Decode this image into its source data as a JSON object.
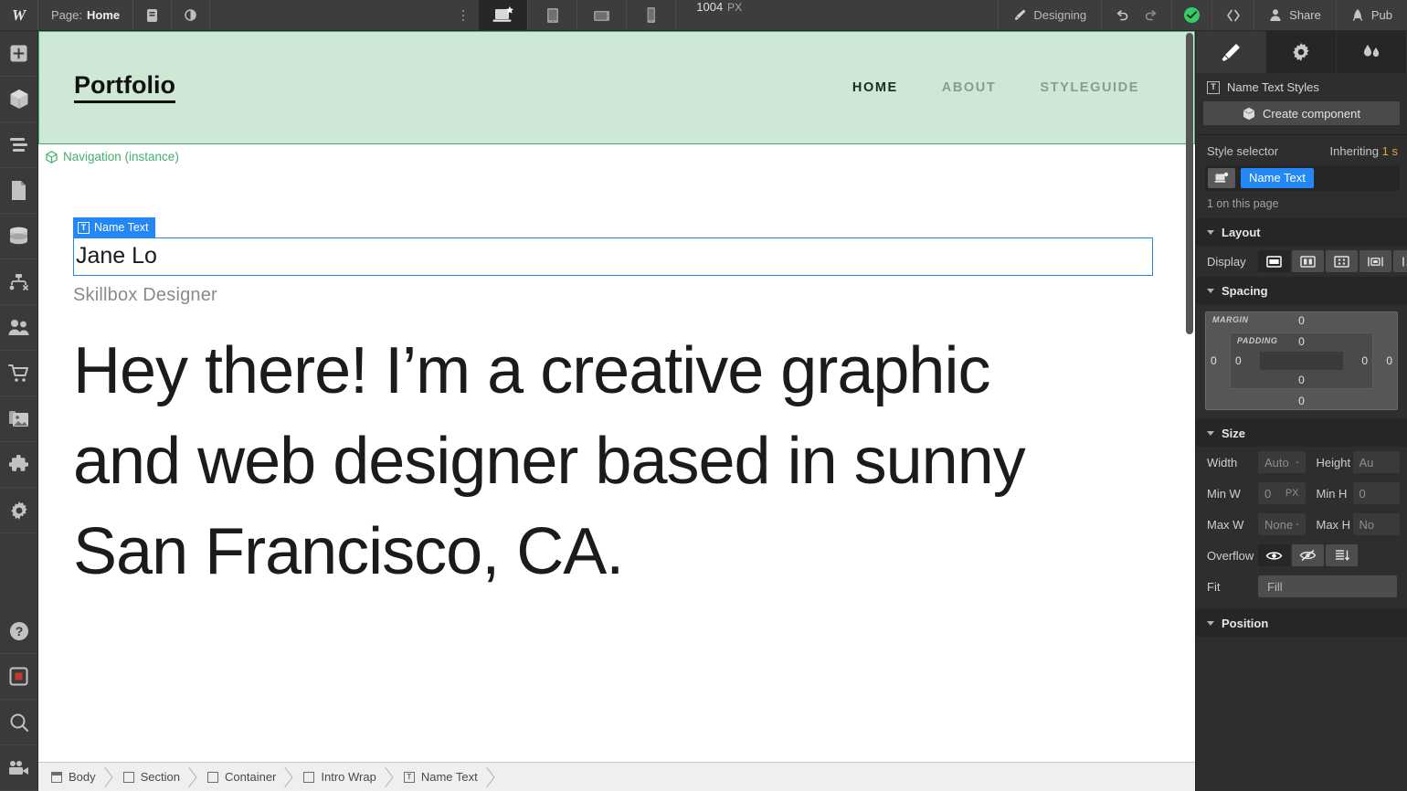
{
  "topbar": {
    "logo": "W",
    "page_label": "Page:",
    "page_name": "Home",
    "viewport_width": "1004",
    "viewport_unit": "PX",
    "mode_label": "Designing",
    "share_label": "Share",
    "publish_label": "Pub",
    "breakpoints": [
      {
        "name": "desktop",
        "active": true
      },
      {
        "name": "tablet",
        "active": false
      },
      {
        "name": "mobile-landscape",
        "active": false
      },
      {
        "name": "mobile-portrait",
        "active": false
      }
    ],
    "icons": [
      "webflow-logo-icon",
      "pages-icon",
      "eye-icon",
      "more-options-icon",
      "brush-icon",
      "undo-icon",
      "redo-icon",
      "check-circle-icon",
      "code-icon",
      "person-icon",
      "rocket-icon"
    ]
  },
  "left_rail": {
    "items": [
      {
        "name": "add-elements-icon"
      },
      {
        "name": "components-icon"
      },
      {
        "name": "navigator-icon"
      },
      {
        "name": "pages-icon"
      },
      {
        "name": "cms-collections-icon"
      },
      {
        "name": "logic-icon"
      },
      {
        "name": "users-icon"
      },
      {
        "name": "ecommerce-icon"
      },
      {
        "name": "assets-icon"
      },
      {
        "name": "apps-icon"
      },
      {
        "name": "settings-icon"
      }
    ],
    "bottom_items": [
      {
        "name": "help-icon"
      },
      {
        "name": "record-icon"
      },
      {
        "name": "search-icon"
      },
      {
        "name": "video-icon"
      }
    ]
  },
  "canvas": {
    "component_badge": "Navigation (instance)",
    "nav": {
      "brand": "Portfolio",
      "links": [
        {
          "label": "HOME",
          "active": true
        },
        {
          "label": "ABOUT",
          "active": false
        },
        {
          "label": "STYLEGUIDE",
          "active": false
        }
      ]
    },
    "selection_badge": "Name Text",
    "name_text": "Jane Lo",
    "role_text": "Skillbox Designer",
    "headline": "Hey there! I’m a creative graphic and web designer based in sunny San Francisco, CA.",
    "accent_green": "#cfe8d6",
    "accent_green_border": "#43b06c",
    "selection_blue": "#2387f5"
  },
  "breadcrumb": {
    "items": [
      {
        "label": "Body",
        "icon": "body-icon"
      },
      {
        "label": "Section",
        "icon": "box-icon"
      },
      {
        "label": "Container",
        "icon": "box-icon"
      },
      {
        "label": "Intro Wrap",
        "icon": "box-icon"
      },
      {
        "label": "Name Text",
        "icon": "text-icon"
      }
    ]
  },
  "right_panel": {
    "tabs": [
      {
        "name": "style-tab",
        "icon": "brush-icon",
        "active": true
      },
      {
        "name": "settings-tab",
        "icon": "gear-icon",
        "active": false
      },
      {
        "name": "interactions-tab",
        "icon": "drops-icon",
        "active": false
      }
    ],
    "element_title": "Name Text Styles",
    "create_component_label": "Create component",
    "style_selector_label": "Style selector",
    "inheriting_label": "Inheriting",
    "inheriting_count": "1",
    "selector_chip": "Name Text",
    "instances_label": "1 on this page",
    "layout": {
      "title": "Layout",
      "display_label": "Display",
      "display_options": [
        {
          "name": "block",
          "active": true
        },
        {
          "name": "flex",
          "active": false
        },
        {
          "name": "grid",
          "active": false
        },
        {
          "name": "inline-block",
          "active": false
        },
        {
          "name": "inline",
          "active": false
        }
      ]
    },
    "spacing": {
      "title": "Spacing",
      "margin_label": "MARGIN",
      "padding_label": "PADDING",
      "margin_top": "0",
      "margin_right": "0",
      "margin_bottom": "0",
      "margin_left": "0",
      "padding_top": "0",
      "padding_right": "0",
      "padding_bottom": "0",
      "padding_left": "0"
    },
    "size": {
      "title": "Size",
      "width_label": "Width",
      "width_value": "Auto",
      "height_label": "Height",
      "height_value": "Au",
      "minw_label": "Min W",
      "minw_value": "0",
      "minw_unit": "PX",
      "minh_label": "Min H",
      "minh_value": "0",
      "maxw_label": "Max W",
      "maxw_value": "None",
      "maxh_label": "Max H",
      "maxh_value": "No",
      "overflow_label": "Overflow",
      "overflow_options": [
        {
          "name": "visible",
          "active": true
        },
        {
          "name": "hidden",
          "active": false
        },
        {
          "name": "scroll",
          "active": false
        }
      ],
      "fit_label": "Fit",
      "fit_value": "Fill"
    },
    "position": {
      "title": "Position"
    }
  }
}
